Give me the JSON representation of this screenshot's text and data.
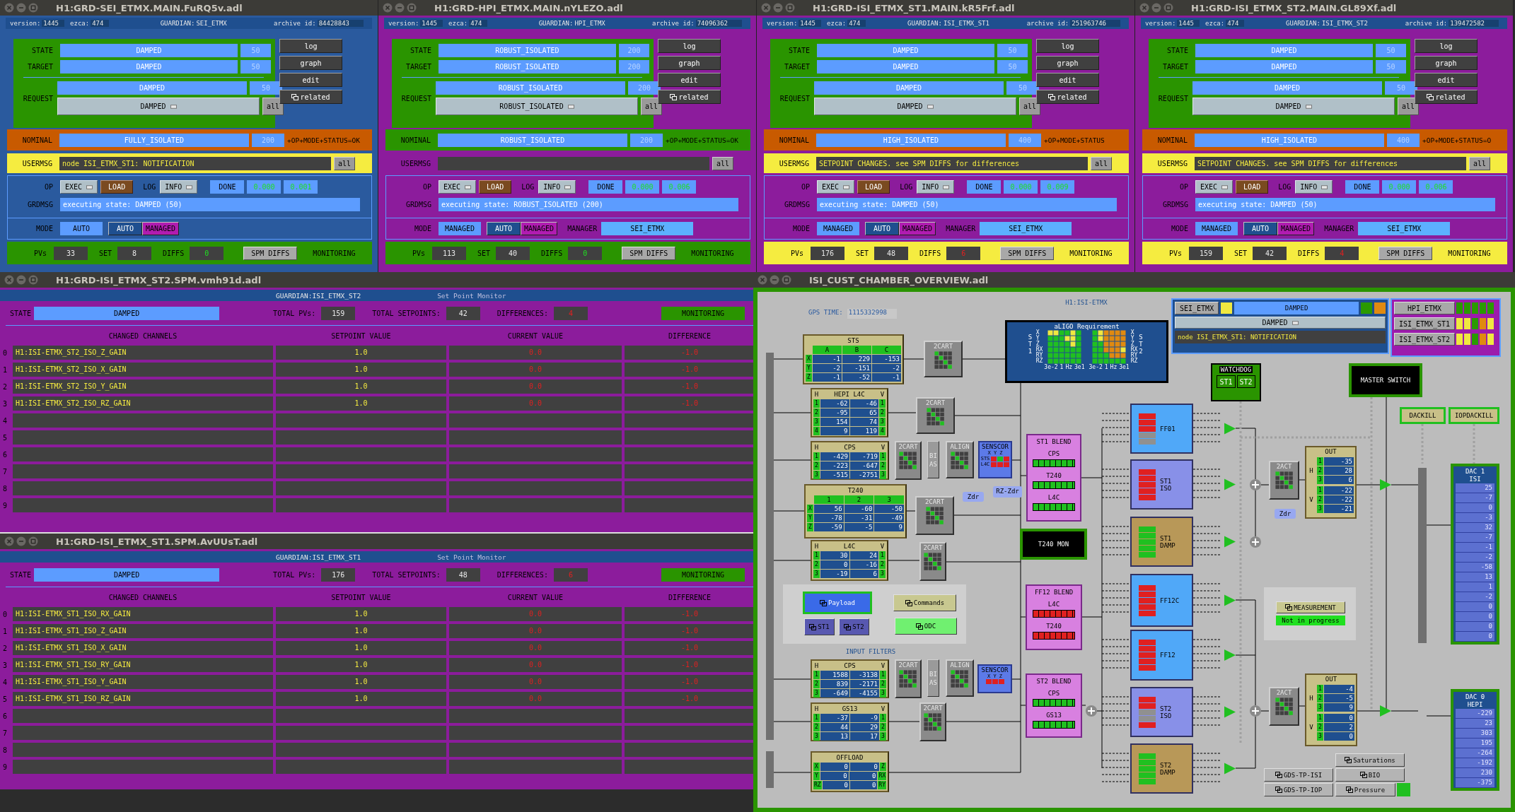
{
  "guardian_windows": [
    {
      "title": "H1:GRD-SEI_ETMX.MAIN.FuRQ5v.adl",
      "color": "#2a5a9e",
      "labels": {
        "version": "version:",
        "ezca": "ezca:",
        "guardian": "GUARDIAN:",
        "archive": "archive id:",
        "state": "STATE",
        "target": "TARGET",
        "request": "REQUEST",
        "all_request": "all",
        "nominal": "NOMINAL",
        "usermsg": "USERMSG",
        "all_usermsg": "all",
        "op": "OP",
        "log": "LOG",
        "grdmsg": "GRDMSG",
        "mode": "MODE",
        "pvs": "PVs",
        "set": "SET",
        "diffs": "DIFFS",
        "spm": "SPM DIFFS",
        "monitoring": "MONITORING"
      },
      "version": "1445",
      "ezca": "474",
      "guardian": "SEI_ETMX",
      "archive_id": "84428843",
      "state": "DAMPED",
      "state_index": "50",
      "target": "DAMPED",
      "target_index": "50",
      "request": "DAMPED",
      "request_index": "50",
      "request_menu": "DAMPED",
      "side_buttons": [
        {
          "kind": "plain",
          "label": "log"
        },
        {
          "kind": "plain",
          "label": "graph"
        },
        {
          "kind": "plain",
          "label": "edit"
        },
        {
          "kind": "related",
          "label": "related"
        }
      ],
      "nominal": "FULLY_ISOLATED",
      "nominal_index": "200",
      "nominal_ok": false,
      "status": "+OP+MODE+STATUS=OK",
      "usermsg": "node ISI_ETMX_ST1: NOTIFICATION",
      "usermsg_alert": true,
      "op": "EXEC",
      "load": "LOAD",
      "log_level": "INFO",
      "done": "DONE",
      "timings": [
        "0.000",
        "0.001"
      ],
      "grdmsg": "executing state: DAMPED (50)",
      "mode": "AUTO",
      "mode_buttons": [
        "AUTO",
        "MANAGED"
      ],
      "pvs": "33",
      "set": "8",
      "diffs": "0",
      "diffs_alert": false
    },
    {
      "title": "H1:GRD-HPI_ETMX.MAIN.nYLEZO.adl",
      "color": "#8c1c9c",
      "labels": {
        "version": "version:",
        "ezca": "ezca:",
        "guardian": "GUARDIAN:",
        "archive": "archive id:",
        "state": "STATE",
        "target": "TARGET",
        "request": "REQUEST",
        "all_request": "all",
        "nominal": "NOMINAL",
        "usermsg": "USERMSG",
        "all_usermsg": "all",
        "op": "OP",
        "log": "LOG",
        "grdmsg": "GRDMSG",
        "mode": "MODE",
        "manager": "MANAGER",
        "pvs": "PVs",
        "set": "SET",
        "diffs": "DIFFS",
        "spm": "SPM DIFFS",
        "monitoring": "MONITORING"
      },
      "version": "1445",
      "ezca": "474",
      "guardian": "HPI_ETMX",
      "archive_id": "74096362",
      "state": "ROBUST_ISOLATED",
      "state_index": "200",
      "target": "ROBUST_ISOLATED",
      "target_index": "200",
      "request": "ROBUST_ISOLATED",
      "request_index": "200",
      "request_menu": "ROBUST_ISOLATED",
      "side_buttons": [
        {
          "kind": "plain",
          "label": "log"
        },
        {
          "kind": "plain",
          "label": "graph"
        },
        {
          "kind": "plain",
          "label": "edit"
        },
        {
          "kind": "related",
          "label": "related"
        }
      ],
      "nominal": "ROBUST_ISOLATED",
      "nominal_index": "200",
      "nominal_ok": true,
      "status": "+OP+MODE+STATUS=OK",
      "usermsg_alert": false,
      "op": "EXEC",
      "load": "LOAD",
      "log_level": "INFO",
      "done": "DONE",
      "timings": [
        "0.000",
        "0.006"
      ],
      "grdmsg": "executing state: ROBUST_ISOLATED (200)",
      "mode": "MANAGED",
      "mode_buttons": [
        "AUTO",
        "MANAGED"
      ],
      "manager": "SEI_ETMX",
      "pvs": "113",
      "set": "40",
      "diffs": "0",
      "diffs_alert": false
    },
    {
      "title": "H1:GRD-ISI_ETMX_ST1.MAIN.kR5Frf.adl",
      "color": "#8c1c9c",
      "labels": {
        "version": "version:",
        "ezca": "ezca:",
        "guardian": "GUARDIAN:",
        "archive": "archive id:",
        "state": "STATE",
        "target": "TARGET",
        "request": "REQUEST",
        "all_request": "all",
        "nominal": "NOMINAL",
        "usermsg": "USERMSG",
        "all_usermsg": "all",
        "op": "OP",
        "log": "LOG",
        "grdmsg": "GRDMSG",
        "mode": "MODE",
        "manager": "MANAGER",
        "pvs": "PVs",
        "set": "SET",
        "diffs": "DIFFS",
        "spm": "SPM DIFFS",
        "monitoring": "MONITORING"
      },
      "version": "1445",
      "ezca": "474",
      "guardian": "ISI_ETMX_ST1",
      "archive_id": "251963746",
      "state": "DAMPED",
      "state_index": "50",
      "target": "DAMPED",
      "target_index": "50",
      "request": "DAMPED",
      "request_index": "50",
      "request_menu": "DAMPED",
      "side_buttons": [
        {
          "kind": "plain",
          "label": "log"
        },
        {
          "kind": "plain",
          "label": "graph"
        },
        {
          "kind": "plain",
          "label": "edit"
        },
        {
          "kind": "related",
          "label": "related"
        }
      ],
      "nominal": "HIGH_ISOLATED",
      "nominal_index": "400",
      "nominal_ok": false,
      "status": "+OP+MODE+STATUS",
      "usermsg": "SETPOINT CHANGES. see SPM DIFFS for differences",
      "usermsg_alert": true,
      "op": "EXEC",
      "load": "LOAD",
      "log_level": "INFO",
      "done": "DONE",
      "timings": [
        "0.000",
        "0.009"
      ],
      "grdmsg": "executing state: DAMPED (50)",
      "mode": "MANAGED",
      "mode_buttons": [
        "AUTO",
        "MANAGED"
      ],
      "manager": "SEI_ETMX",
      "pvs": "176",
      "set": "48",
      "diffs": "6",
      "diffs_alert": true
    },
    {
      "title": "H1:GRD-ISI_ETMX_ST2.MAIN.GL89Xf.adl",
      "color": "#8c1c9c",
      "labels": {
        "version": "version:",
        "ezca": "ezca:",
        "guardian": "GUARDIAN:",
        "archive": "archive id:",
        "state": "STATE",
        "target": "TARGET",
        "request": "REQUEST",
        "all_request": "all",
        "nominal": "NOMINAL",
        "usermsg": "USERMSG",
        "all_usermsg": "all",
        "op": "OP",
        "log": "LOG",
        "grdmsg": "GRDMSG",
        "mode": "MODE",
        "manager": "MANAGER",
        "pvs": "PVs",
        "set": "SET",
        "diffs": "DIFFS",
        "spm": "SPM DIFFS",
        "monitoring": "MONITORING"
      },
      "version": "1445",
      "ezca": "474",
      "guardian": "ISI_ETMX_ST2",
      "archive_id": "139472582",
      "state": "DAMPED",
      "state_index": "50",
      "target": "DAMPED",
      "target_index": "50",
      "request": "DAMPED",
      "request_index": "50",
      "request_menu": "DAMPED",
      "side_buttons": [
        {
          "kind": "plain",
          "label": "log"
        },
        {
          "kind": "plain",
          "label": "graph"
        },
        {
          "kind": "plain",
          "label": "edit"
        },
        {
          "kind": "related",
          "label": "related"
        }
      ],
      "nominal": "HIGH_ISOLATED",
      "nominal_index": "400",
      "nominal_ok": false,
      "status": "+OP+MODE+STATUS=O",
      "usermsg": "SETPOINT CHANGES. see SPM DIFFS for differences",
      "usermsg_alert": true,
      "op": "EXEC",
      "load": "LOAD",
      "log_level": "INFO",
      "done": "DONE",
      "timings": [
        "0.000",
        "0.006"
      ],
      "grdmsg": "executing state: DAMPED (50)",
      "mode": "MANAGED",
      "mode_buttons": [
        "AUTO",
        "MANAGED"
      ],
      "manager": "SEI_ETMX",
      "pvs": "159",
      "set": "42",
      "diffs": "4",
      "diffs_alert": true
    }
  ],
  "spm_windows": [
    {
      "title": "H1:GRD-ISI_ETMX_ST2.SPM.vmh91d.adl",
      "guardian_label": "GUARDIAN:",
      "guardian": "ISI_ETMX_ST2",
      "subtitle": "Set Point Monitor",
      "state_label": "STATE",
      "state": "DAMPED",
      "total_pvs_label": "TOTAL PVs:",
      "total_pvs": "159",
      "total_setpoints_label": "TOTAL SETPOINTS:",
      "total_setpoints": "42",
      "differences_label": "DIFFERENCES:",
      "differences": "4",
      "monitoring": "MONITORING",
      "columns": [
        "CHANGED CHANNELS",
        "SETPOINT VALUE",
        "CURRENT VALUE",
        "DIFFERENCE"
      ],
      "rows": [
        {
          "index": "0",
          "channel": "H1:ISI-ETMX_ST2_ISO_Z_GAIN",
          "setpoint": "1.0",
          "current": "0.0",
          "difference": "-1.0"
        },
        {
          "index": "1",
          "channel": "H1:ISI-ETMX_ST2_ISO_X_GAIN",
          "setpoint": "1.0",
          "current": "0.0",
          "difference": "-1.0"
        },
        {
          "index": "2",
          "channel": "H1:ISI-ETMX_ST2_ISO_Y_GAIN",
          "setpoint": "1.0",
          "current": "0.0",
          "difference": "-1.0"
        },
        {
          "index": "3",
          "channel": "H1:ISI-ETMX_ST2_ISO_RZ_GAIN",
          "setpoint": "1.0",
          "current": "0.0",
          "difference": "-1.0"
        },
        {
          "index": "4"
        },
        {
          "index": "5"
        },
        {
          "index": "6"
        },
        {
          "index": "7"
        },
        {
          "index": "8"
        },
        {
          "index": "9"
        }
      ]
    },
    {
      "title": "H1:GRD-ISI_ETMX_ST1.SPM.AvUUsT.adl",
      "guardian_label": "GUARDIAN:",
      "guardian": "ISI_ETMX_ST1",
      "subtitle": "Set Point Monitor",
      "state_label": "STATE",
      "state": "DAMPED",
      "total_pvs_label": "TOTAL PVs:",
      "total_pvs": "176",
      "total_setpoints_label": "TOTAL SETPOINTS:",
      "total_setpoints": "48",
      "differences_label": "DIFFERENCES:",
      "differences": "6",
      "monitoring": "MONITORING",
      "columns": [
        "CHANGED CHANNELS",
        "SETPOINT VALUE",
        "CURRENT VALUE",
        "DIFFERENCE"
      ],
      "rows": [
        {
          "index": "0",
          "channel": "H1:ISI-ETMX_ST1_ISO_RX_GAIN",
          "setpoint": "1.0",
          "current": "0.0",
          "difference": "-1.0"
        },
        {
          "index": "1",
          "channel": "H1:ISI-ETMX_ST1_ISO_Z_GAIN",
          "setpoint": "1.0",
          "current": "0.0",
          "difference": "-1.0"
        },
        {
          "index": "2",
          "channel": "H1:ISI-ETMX_ST1_ISO_X_GAIN",
          "setpoint": "1.0",
          "current": "0.0",
          "difference": "-1.0"
        },
        {
          "index": "3",
          "channel": "H1:ISI-ETMX_ST1_ISO_RY_GAIN",
          "setpoint": "1.0",
          "current": "0.0",
          "difference": "-1.0"
        },
        {
          "index": "4",
          "channel": "H1:ISI-ETMX_ST1_ISO_Y_GAIN",
          "setpoint": "1.0",
          "current": "0.0",
          "difference": "-1.0"
        },
        {
          "index": "5",
          "channel": "H1:ISI-ETMX_ST1_ISO_RZ_GAIN",
          "setpoint": "1.0",
          "current": "0.0",
          "difference": "-1.0"
        },
        {
          "index": "6"
        },
        {
          "index": "7"
        },
        {
          "index": "8"
        },
        {
          "index": "9"
        }
      ]
    }
  ],
  "overview": {
    "title": "ISI_CUST_CHAMBER_OVERVIEW.adl",
    "nodes": [
      {
        "kind": "gps",
        "label": "GPS TIME:",
        "value": "1115332998"
      },
      {
        "kind": "caption",
        "text": "H1:ISI-ETMX"
      },
      {
        "kind": "requirement",
        "title": "aLIGO Requirement",
        "stages": [
          {
            "name": "ST1",
            "dofs": [
              "X",
              "Y",
              "Z",
              "RX",
              "RY",
              "RZ"
            ],
            "ticks": [
              "3e-2",
              "1",
              "Hz",
              "3e1"
            ]
          },
          {
            "name": "ST2",
            "dofs": [
              "X",
              "Y",
              "Z",
              "RX",
              "RY",
              "RZ"
            ],
            "ticks": [
              "3e-2",
              "1",
              "Hz",
              "3e1"
            ]
          }
        ]
      },
      {
        "kind": "guardian",
        "button": "SEI_ETMX",
        "lamp": {
          "color": "#f0e840"
        },
        "state": "DAMPED",
        "lamps": [
          {
            "color": "#2a9a00"
          },
          {
            "color": "#e08a10"
          }
        ],
        "menu": "DAMPED",
        "message": "node ISI_ETMX_ST1: NOTIFICATION"
      },
      {
        "kind": "subguardians",
        "items": [
          {
            "name": "HPI_ETMX",
            "lamps": [
              {
                "color": "#2a9a00"
              },
              {
                "color": "#2a9a00"
              },
              {
                "color": "#2a9a00"
              },
              {
                "color": "#2a9a00"
              },
              {
                "color": "#2a9a00"
              }
            ]
          },
          {
            "name": "ISI_ETMX_ST1",
            "lamps": [
              {
                "color": "#f0e840"
              },
              {
                "color": "#f0e840"
              },
              {
                "color": "#2a9a00"
              },
              {
                "color": "#e08a10"
              },
              {
                "color": "#f0e840"
              }
            ]
          },
          {
            "name": "ISI_ETMX_ST2",
            "lamps": [
              {
                "color": "#f0e840"
              },
              {
                "color": "#f0e840"
              },
              {
                "color": "#2a9a00"
              },
              {
                "color": "#e08a10"
              },
              {
                "color": "#f0e840"
              }
            ]
          }
        ]
      },
      {
        "kind": "table",
        "title": "STS",
        "columns": [
          "A",
          "B",
          "C"
        ],
        "left_labels": [
          "X",
          "Y",
          "Z"
        ],
        "rows": [
          [
            "-1",
            "229",
            "-153"
          ],
          [
            "-2",
            "-151",
            "-2"
          ],
          [
            "-1",
            "-52",
            "-1"
          ]
        ]
      },
      {
        "kind": "cart",
        "text": "2CART"
      },
      {
        "kind": "table",
        "title": "HEPI L4C",
        "corner_left": "H",
        "corner_right": "V",
        "left_labels": [
          "1",
          "2",
          "3",
          "4"
        ],
        "right_labels": [
          "1",
          "2",
          "3",
          "4"
        ],
        "rows": [
          [
            "-62",
            "-46"
          ],
          [
            "-95",
            "65"
          ],
          [
            "154",
            "74"
          ],
          [
            "9",
            "119"
          ]
        ]
      },
      {
        "kind": "cart",
        "text": "2CART"
      },
      {
        "kind": "table",
        "title": "CPS",
        "corner_left": "H",
        "corner_right": "V",
        "left_labels": [
          "1",
          "2",
          "3"
        ],
        "right_labels": [
          "1",
          "2",
          "3"
        ],
        "rows": [
          [
            "-429",
            "-719"
          ],
          [
            "-223",
            "-647"
          ],
          [
            "-515",
            "-2751"
          ]
        ]
      },
      {
        "kind": "cart",
        "text": "2CART"
      },
      {
        "kind": "bias",
        "text": "BIAS"
      },
      {
        "kind": "align",
        "text": "ALIGN"
      },
      {
        "kind": "senscor",
        "text": "SENSCOR",
        "axes": "X Y Z",
        "rows": [
          {
            "label": "STS",
            "lamps": [
              {
                "color": "#e02020"
              },
              {
                "color": "#20c020"
              },
              {
                "color": "#e02020"
              }
            ]
          },
          {
            "label": "L4C",
            "lamps": [
              {
                "color": "#e02020"
              },
              {
                "color": "#e02020"
              },
              {
                "color": "#e02020"
              }
            ]
          }
        ]
      },
      {
        "kind": "table",
        "title": "T240",
        "columns": [
          "1",
          "2",
          "3"
        ],
        "left_labels": [
          "X",
          "Y",
          "Z"
        ],
        "rows": [
          [
            "56",
            "-60",
            "-50"
          ],
          [
            "-78",
            "-31",
            "-49"
          ],
          [
            "-59",
            "-5",
            "9"
          ]
        ]
      },
      {
        "kind": "cart",
        "text": "2CART"
      },
      {
        "kind": "tag",
        "text": "Zdr"
      },
      {
        "kind": "tag",
        "text": "RZ-Zdr"
      },
      {
        "kind": "blend",
        "title": "ST1 BLEND",
        "channels": [
          {
            "name": "CPS",
            "color": "#20c020"
          },
          {
            "name": "T240",
            "color": "#20c020"
          },
          {
            "name": "L4C",
            "color": "#20c020"
          }
        ]
      },
      {
        "kind": "filter",
        "text": "FF01",
        "color": "#50a8f8",
        "lamps": [
          {
            "color": "#e02020"
          },
          {
            "color": "#e02020"
          },
          {
            "color": "#e02020"
          },
          {
            "color": "#909090"
          },
          {
            "color": "#909090"
          }
        ]
      },
      {
        "kind": "filter",
        "text": "ST1 ISO",
        "color": "#8890e8",
        "lamps": [
          {
            "color": "#e02020"
          },
          {
            "color": "#e02020"
          },
          {
            "color": "#e02020"
          },
          {
            "color": "#e02020"
          },
          {
            "color": "#e02020"
          }
        ]
      },
      {
        "kind": "filter",
        "text": "ST1 DAMP",
        "color": "#b89858",
        "lamps": [
          {
            "color": "#20c020"
          },
          {
            "color": "#20c020"
          },
          {
            "color": "#20c020"
          },
          {
            "color": "#20c020"
          },
          {
            "color": "#20c020"
          }
        ]
      },
      {
        "kind": "watchdog",
        "title": "WATCHDOG",
        "stages": [
          "ST1",
          "ST2"
        ]
      },
      {
        "kind": "monitor",
        "text": "MASTER SWITCH"
      },
      {
        "kind": "kill",
        "text": "DACKILL"
      },
      {
        "kind": "kill",
        "text": "IOPDACKILL"
      },
      {
        "kind": "cart",
        "text": "2ACT"
      },
      {
        "kind": "tag",
        "text": "Zdr"
      },
      {
        "kind": "out",
        "title": "OUT",
        "groups": [
          {
            "label": "H",
            "channels": [
              "1",
              "2",
              "3"
            ],
            "values": [
              "-35",
              "28",
              "6"
            ]
          },
          {
            "label": "V",
            "channels": [
              "1",
              "2",
              "3"
            ],
            "values": [
              "-22",
              "-22",
              "-21"
            ]
          }
        ]
      },
      {
        "kind": "dac",
        "title": "DAC 1",
        "subtitle": "ISI",
        "values": [
          "25",
          "-7",
          "0",
          "-3",
          "32",
          "-7",
          "-1",
          "-2",
          "-58",
          "13",
          "1",
          "-2",
          "0",
          "0",
          "0",
          "0"
        ]
      },
      {
        "kind": "table",
        "title": "L4C",
        "corner_left": "H",
        "corner_right": "V",
        "left_labels": [
          "1",
          "2",
          "3"
        ],
        "right_labels": [
          "1",
          "2",
          "3"
        ],
        "rows": [
          [
            "30",
            "24"
          ],
          [
            "0",
            "-16"
          ],
          [
            "-19",
            "6"
          ]
        ]
      },
      {
        "kind": "cart",
        "text": "2CART"
      },
      {
        "kind": "monitor",
        "text": "T240 MON"
      },
      {
        "kind": "link",
        "text": "Payload",
        "color": "#3a6ae8"
      },
      {
        "kind": "link",
        "text": "Commands",
        "color": "#c8c890"
      },
      {
        "kind": "link",
        "text": "ST1",
        "color": "#5858b0"
      },
      {
        "kind": "link",
        "text": "ST2",
        "color": "#5858b0"
      },
      {
        "kind": "link",
        "text": "ODC",
        "color": "#70f070"
      },
      {
        "kind": "blend",
        "title": "FF12 BLEND",
        "channels": [
          {
            "name": "L4C",
            "color": "#e02020"
          },
          {
            "name": "T240",
            "color": "#e02020"
          }
        ]
      },
      {
        "kind": "filter",
        "text": "FF12C",
        "color": "#50a8f8",
        "lamps": [
          {
            "color": "#e02020"
          },
          {
            "color": "#e02020"
          },
          {
            "color": "#e02020"
          },
          {
            "color": "#e02020"
          },
          {
            "color": "#e02020"
          }
        ]
      },
      {
        "kind": "filter",
        "text": "FF12",
        "color": "#50a8f8",
        "lamps": [
          {
            "color": "#e02020"
          },
          {
            "color": "#e02020"
          },
          {
            "color": "#e02020"
          },
          {
            "color": "#e02020"
          },
          {
            "color": "#e02020"
          }
        ]
      },
      {
        "kind": "link",
        "text": "MEASUREMENT",
        "color": "#c8c890"
      },
      {
        "kind": "status",
        "text": "Not in progress",
        "color": "#20e020"
      },
      {
        "kind": "caption",
        "text": "INPUT FILTERS"
      },
      {
        "kind": "table",
        "title": "CPS",
        "corner_left": "H",
        "corner_right": "V",
        "left_labels": [
          "1",
          "2",
          "3"
        ],
        "right_labels": [
          "1",
          "2",
          "3"
        ],
        "rows": [
          [
            "1588",
            "-3138"
          ],
          [
            "839",
            "-2171"
          ],
          [
            "-649",
            "-4155"
          ]
        ]
      },
      {
        "kind": "cart",
        "text": "2CART"
      },
      {
        "kind": "bias",
        "text": "BIAS"
      },
      {
        "kind": "align",
        "text": "ALIGN"
      },
      {
        "kind": "senscor",
        "text": "SENSCOR",
        "axes": "X Y Z",
        "rows": [
          {
            "lamps": [
              {
                "color": "#e02020"
              },
              {
                "color": "#e02020"
              },
              {
                "color": "#e02020"
              }
            ]
          }
        ]
      },
      {
        "kind": "table",
        "title": "GS13",
        "corner_left": "H",
        "corner_right": "V",
        "left_labels": [
          "1",
          "2",
          "3"
        ],
        "right_labels": [
          "1",
          "2",
          "3"
        ],
        "rows": [
          [
            "-37",
            "-9"
          ],
          [
            "44",
            "29"
          ],
          [
            "13",
            "17"
          ]
        ]
      },
      {
        "kind": "cart",
        "text": "2CART"
      },
      {
        "kind": "table",
        "title": "OFFLOAD",
        "left_labels": [
          "X",
          "Y",
          "RZ"
        ],
        "right_labels": [
          "Z",
          "RX",
          "RY"
        ],
        "rows": [
          [
            "0",
            "0"
          ],
          [
            "0",
            "0"
          ],
          [
            "0",
            "0"
          ]
        ]
      },
      {
        "kind": "blend",
        "title": "ST2 BLEND",
        "channels": [
          {
            "name": "CPS",
            "color": "#20c020"
          },
          {
            "name": "GS13",
            "color": "#20c020"
          }
        ]
      },
      {
        "kind": "filter",
        "text": "ST2 ISO",
        "color": "#8890e8",
        "lamps": [
          {
            "color": "#e02020"
          },
          {
            "color": "#e02020"
          },
          {
            "color": "#909090"
          },
          {
            "color": "#909090"
          },
          {
            "color": "#e02020"
          }
        ]
      },
      {
        "kind": "filter",
        "text": "ST2 DAMP",
        "color": "#b89858",
        "lamps": [
          {
            "color": "#20c020"
          },
          {
            "color": "#20c020"
          },
          {
            "color": "#20c020"
          },
          {
            "color": "#20c020"
          },
          {
            "color": "#20c020"
          }
        ]
      },
      {
        "kind": "cart",
        "text": "2ACT"
      },
      {
        "kind": "out",
        "title": "OUT",
        "groups": [
          {
            "label": "H",
            "channels": [
              "1",
              "2",
              "3"
            ],
            "values": [
              "-4",
              "-5",
              "9"
            ]
          },
          {
            "label": "V",
            "channels": [
              "1",
              "2",
              "3"
            ],
            "values": [
              "0",
              "2",
              "0"
            ]
          }
        ]
      },
      {
        "kind": "dac",
        "title": "DAC 0",
        "subtitle": "HEPI",
        "values": [
          "-229",
          "23",
          "303",
          "195",
          "-264",
          "-192",
          "230",
          "-375"
        ]
      },
      {
        "kind": "link",
        "text": "Saturations",
        "color": "#b4b4b4"
      },
      {
        "kind": "link",
        "text": "GDS-TP-ISI",
        "color": "#b4b4b4"
      },
      {
        "kind": "link",
        "text": "BIO",
        "color": "#b4b4b4"
      },
      {
        "kind": "link",
        "text": "GDS-TP-IOP",
        "color": "#b4b4b4"
      },
      {
        "kind": "link",
        "text": "Pressure",
        "color": "#b4b4b4"
      },
      {
        "kind": "lamp",
        "color": "#20c020"
      }
    ]
  }
}
